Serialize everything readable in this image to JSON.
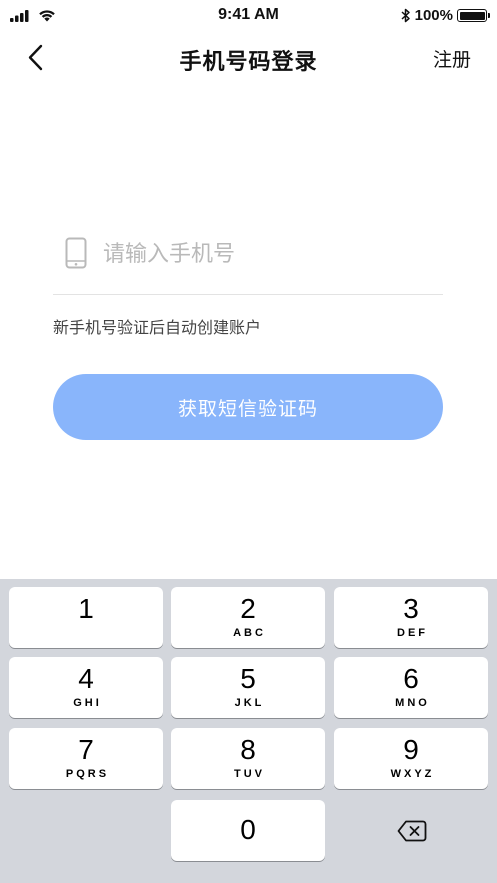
{
  "status_bar": {
    "time": "9:41 AM",
    "battery_text": "100%",
    "battery_level": 1.0,
    "icons": [
      "signal-icon",
      "wifi-icon",
      "bluetooth-icon",
      "battery-icon"
    ]
  },
  "nav": {
    "title": "手机号码登录",
    "register_label": "注册",
    "back_icon": "chevron-left-icon"
  },
  "form": {
    "phone_placeholder": "请输入手机号",
    "phone_value": "",
    "phone_icon": "mobile-phone-icon",
    "hint": "新手机号验证后自动创建账户",
    "submit_label": "获取短信验证码"
  },
  "colors": {
    "primary_button": "#89b5fb",
    "keypad_background": "#d3d6dc"
  },
  "keypad": {
    "keys": [
      {
        "digit": "1",
        "letters": ""
      },
      {
        "digit": "2",
        "letters": "ABC"
      },
      {
        "digit": "3",
        "letters": "DEF"
      },
      {
        "digit": "4",
        "letters": "GHI"
      },
      {
        "digit": "5",
        "letters": "JKL"
      },
      {
        "digit": "6",
        "letters": "MNO"
      },
      {
        "digit": "7",
        "letters": "PQRS"
      },
      {
        "digit": "8",
        "letters": "TUV"
      },
      {
        "digit": "9",
        "letters": "WXYZ"
      },
      {
        "digit": "0",
        "letters": ""
      }
    ],
    "delete_icon": "backspace-icon"
  }
}
